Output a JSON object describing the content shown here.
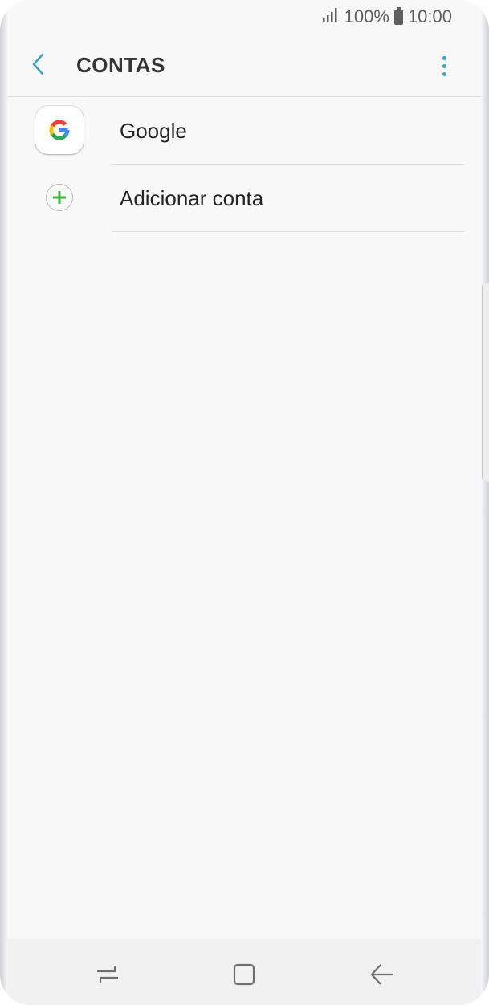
{
  "status_bar": {
    "signal_icon": "signal-icon",
    "battery_text": "100%",
    "battery_icon": "battery-icon",
    "time": "10:00"
  },
  "header": {
    "back_icon": "chevron-left-icon",
    "title": "CONTAS",
    "more_icon": "more-vertical-icon"
  },
  "accounts": {
    "items": [
      {
        "label": "Google",
        "icon": "google-icon"
      },
      {
        "label": "Adicionar conta",
        "icon": "add-circle-icon"
      }
    ]
  },
  "nav_bar": {
    "recents_icon": "recents-icon",
    "home_icon": "home-icon",
    "back_icon": "back-arrow-icon"
  },
  "colors": {
    "accent": "#3f9fc0",
    "add_green": "#3cb43c",
    "background": "#f8f8f8",
    "text": "#252525"
  }
}
